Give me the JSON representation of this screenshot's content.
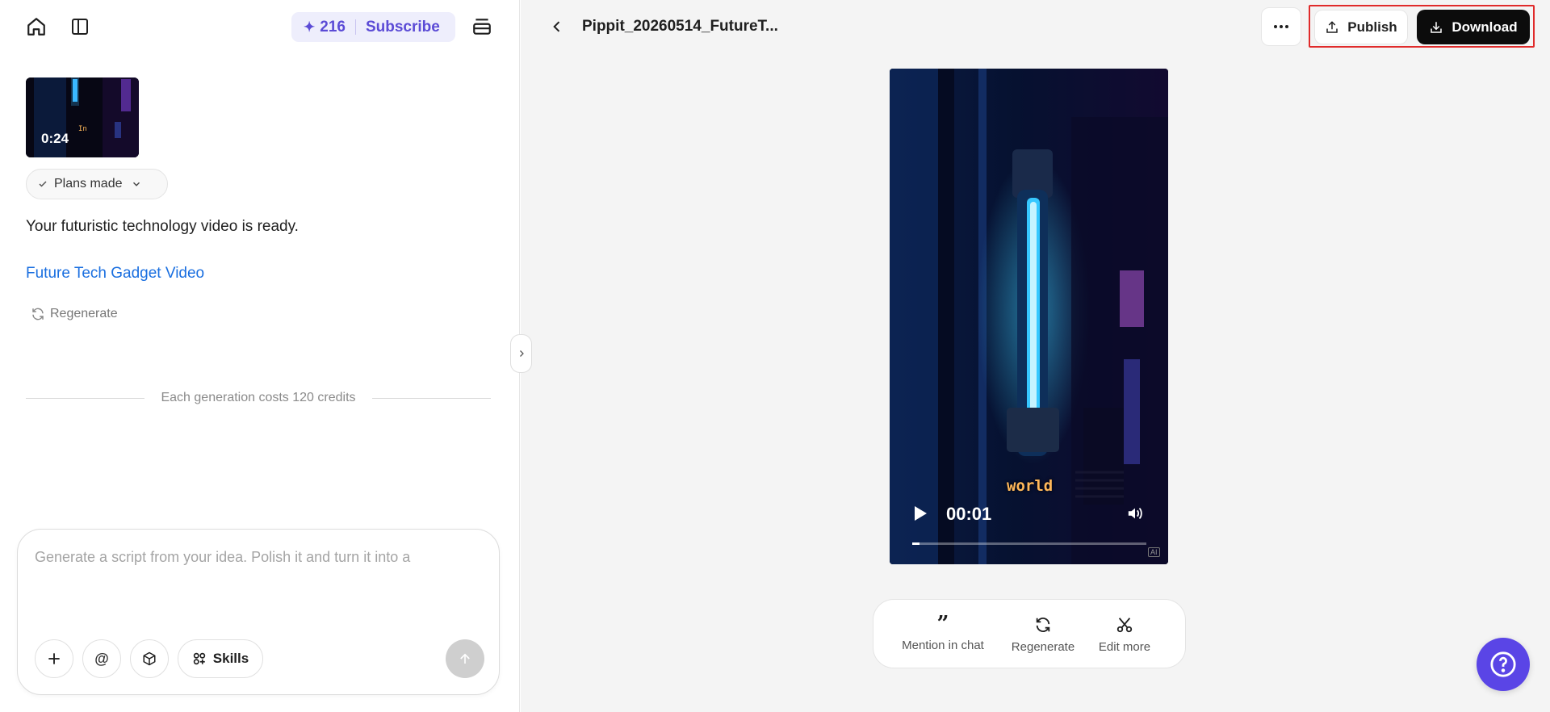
{
  "left_panel": {
    "credits": {
      "count": "216",
      "subscribe_label": "Subscribe"
    },
    "thumbnail": {
      "duration": "0:24"
    },
    "plans_label": "Plans made",
    "ready_message": "Your futuristic technology video is ready.",
    "video_link": "Future Tech Gadget Video",
    "regenerate_label": "Regenerate",
    "cost_note": "Each generation costs 120 credits",
    "composer": {
      "prompt_text": "Generate a script from your idea. Polish it and turn it into a",
      "mention_symbol": "@",
      "skills_label": "Skills"
    }
  },
  "right_panel": {
    "file_title": "Pippit_20260514_FutureT...",
    "publish_label": "Publish",
    "download_label": "Download",
    "player": {
      "caption_word": "world",
      "current_time": "00:01",
      "progress_fraction": 0.03,
      "badge": "AI"
    },
    "actions": {
      "mention_label": "Mention in chat",
      "regenerate_label": "Regenerate",
      "edit_label": "Edit more"
    }
  },
  "colors": {
    "accent": "#5a45e6",
    "link": "#1a6fe0",
    "highlight_box": "#e02b2b",
    "download_bg": "#0c0c0c"
  }
}
